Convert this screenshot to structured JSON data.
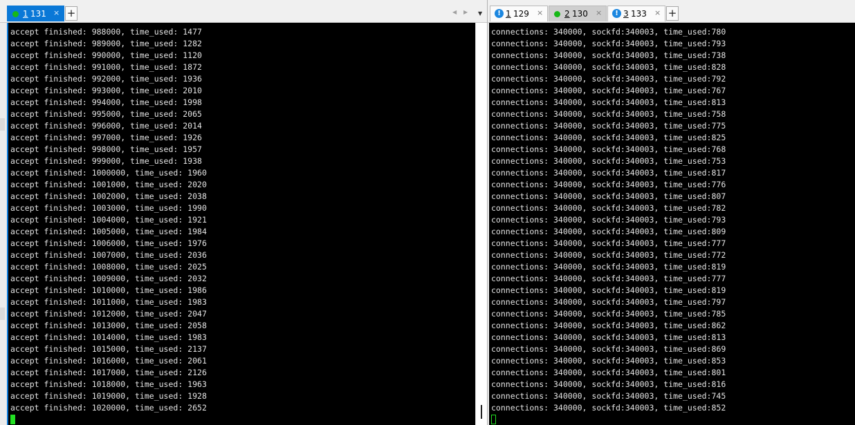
{
  "left_pane": {
    "tabs": [
      {
        "num": "1",
        "name": "131",
        "status": "connected",
        "active": true,
        "close": "×"
      }
    ],
    "add_label": "+",
    "nav": {
      "prev": "◀",
      "next": "▶",
      "menu": "▼"
    },
    "lines": [
      "accept finished: 988000, time_used: 1477",
      "accept finished: 989000, time_used: 1282",
      "accept finished: 990000, time_used: 1120",
      "accept finished: 991000, time_used: 1872",
      "accept finished: 992000, time_used: 1936",
      "accept finished: 993000, time_used: 2010",
      "accept finished: 994000, time_used: 1998",
      "accept finished: 995000, time_used: 2065",
      "accept finished: 996000, time_used: 2014",
      "accept finished: 997000, time_used: 1926",
      "accept finished: 998000, time_used: 1957",
      "accept finished: 999000, time_used: 1938",
      "accept finished: 1000000, time_used: 1960",
      "accept finished: 1001000, time_used: 2020",
      "accept finished: 1002000, time_used: 2038",
      "accept finished: 1003000, time_used: 1990",
      "accept finished: 1004000, time_used: 1921",
      "accept finished: 1005000, time_used: 1984",
      "accept finished: 1006000, time_used: 1976",
      "accept finished: 1007000, time_used: 2036",
      "accept finished: 1008000, time_used: 2025",
      "accept finished: 1009000, time_used: 2032",
      "accept finished: 1010000, time_used: 1986",
      "accept finished: 1011000, time_used: 1983",
      "accept finished: 1012000, time_used: 2047",
      "accept finished: 1013000, time_used: 2058",
      "accept finished: 1014000, time_used: 1983",
      "accept finished: 1015000, time_used: 2137",
      "accept finished: 1016000, time_used: 2061",
      "accept finished: 1017000, time_used: 2126",
      "accept finished: 1018000, time_used: 1963",
      "accept finished: 1019000, time_used: 1928",
      "accept finished: 1020000, time_used: 2652"
    ]
  },
  "right_pane": {
    "tabs": [
      {
        "num": "1",
        "name": "129",
        "status": "warning",
        "active": false,
        "close": "×",
        "icon": "!"
      },
      {
        "num": "2",
        "name": "130",
        "status": "connected",
        "active": false,
        "close": "×"
      },
      {
        "num": "3",
        "name": "133",
        "status": "warning",
        "active": false,
        "close": "×",
        "icon": "!"
      }
    ],
    "add_label": "+",
    "lines": [
      "connections: 340000, sockfd:340003, time_used:780",
      "connections: 340000, sockfd:340003, time_used:793",
      "connections: 340000, sockfd:340003, time_used:738",
      "connections: 340000, sockfd:340003, time_used:828",
      "connections: 340000, sockfd:340003, time_used:792",
      "connections: 340000, sockfd:340003, time_used:767",
      "connections: 340000, sockfd:340003, time_used:813",
      "connections: 340000, sockfd:340003, time_used:758",
      "connections: 340000, sockfd:340003, time_used:775",
      "connections: 340000, sockfd:340003, time_used:825",
      "connections: 340000, sockfd:340003, time_used:768",
      "connections: 340000, sockfd:340003, time_used:753",
      "connections: 340000, sockfd:340003, time_used:817",
      "connections: 340000, sockfd:340003, time_used:776",
      "connections: 340000, sockfd:340003, time_used:807",
      "connections: 340000, sockfd:340003, time_used:782",
      "connections: 340000, sockfd:340003, time_used:793",
      "connections: 340000, sockfd:340003, time_used:809",
      "connections: 340000, sockfd:340003, time_used:777",
      "connections: 340000, sockfd:340003, time_used:772",
      "connections: 340000, sockfd:340003, time_used:819",
      "connections: 340000, sockfd:340003, time_used:777",
      "connections: 340000, sockfd:340003, time_used:819",
      "connections: 340000, sockfd:340003, time_used:797",
      "connections: 340000, sockfd:340003, time_used:785",
      "connections: 340000, sockfd:340003, time_used:862",
      "connections: 340000, sockfd:340003, time_used:813",
      "connections: 340000, sockfd:340003, time_used:869",
      "connections: 340000, sockfd:340003, time_used:853",
      "connections: 340000, sockfd:340003, time_used:801",
      "connections: 340000, sockfd:340003, time_used:816",
      "connections: 340000, sockfd:340003, time_used:745",
      "connections: 340000, sockfd:340003, time_used:852"
    ]
  },
  "colors": {
    "active_tab": "#0a78d7",
    "connected_dot": "#17b817",
    "warning_icon": "#1c87e0",
    "terminal_bg": "#000000",
    "terminal_text": "#e4e4e4",
    "cursor": "#22e022"
  },
  "icons": {
    "connected": "status-dot-icon",
    "warning": "warning-icon",
    "close": "close-icon",
    "add": "plus-icon"
  }
}
